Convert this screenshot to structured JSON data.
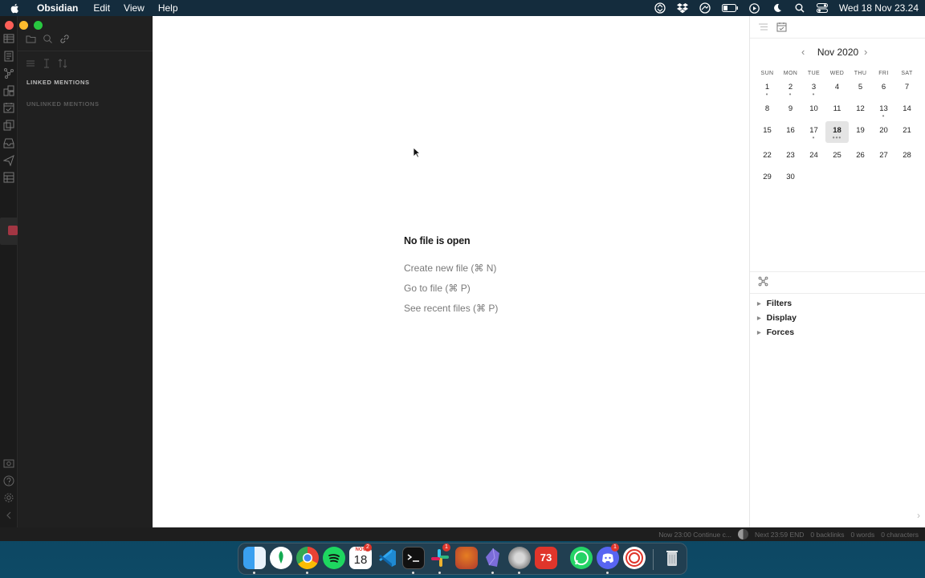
{
  "menubar": {
    "app_name": "Obsidian",
    "menus": [
      "Edit",
      "View",
      "Help"
    ],
    "clock": "Wed 18 Nov  23.24"
  },
  "left_panel": {
    "linked_mentions": "LINKED MENTIONS",
    "unlinked_mentions": "UNLINKED MENTIONS"
  },
  "main": {
    "empty_title": "No file is open",
    "actions": [
      "Create new file (⌘ N)",
      "Go to file (⌘ P)",
      "See recent files (⌘ P)"
    ]
  },
  "calendar": {
    "month_label": "Nov 2020",
    "prev_icon": "‹",
    "next_icon": "›",
    "dows": [
      "SUN",
      "MON",
      "TUE",
      "WED",
      "THU",
      "FRI",
      "SAT"
    ],
    "weeks": [
      [
        "1",
        "2",
        "3",
        "4",
        "5",
        "6",
        "7"
      ],
      [
        "8",
        "9",
        "10",
        "11",
        "12",
        "13",
        "14"
      ],
      [
        "15",
        "16",
        "17",
        "18",
        "19",
        "20",
        "21"
      ],
      [
        "22",
        "23",
        "24",
        "25",
        "26",
        "27",
        "28"
      ],
      [
        "29",
        "30",
        "",
        "",
        "",
        "",
        ""
      ]
    ],
    "today": "18",
    "dotted_days": [
      "1",
      "2",
      "3",
      "13",
      "17"
    ],
    "today_dots": "•••"
  },
  "graph_controls": {
    "items": [
      "Filters",
      "Display",
      "Forces"
    ]
  },
  "status_bar": {
    "now": "Now 23:00 Continue c...",
    "next": "Next 23:59 END",
    "backlinks": "0 backlinks",
    "words": "0 words",
    "characters": "0 characters"
  },
  "dock": {
    "calendar_month": "NOV",
    "calendar_day": "18",
    "calendar_badge": "2",
    "slack_badge": "1",
    "counter_app_label": "73",
    "discord_badge": "1"
  },
  "colors": {
    "accent": "#7b6cd9",
    "close": "#fe5f57",
    "minimize": "#febc2e",
    "maximize": "#28c840"
  }
}
